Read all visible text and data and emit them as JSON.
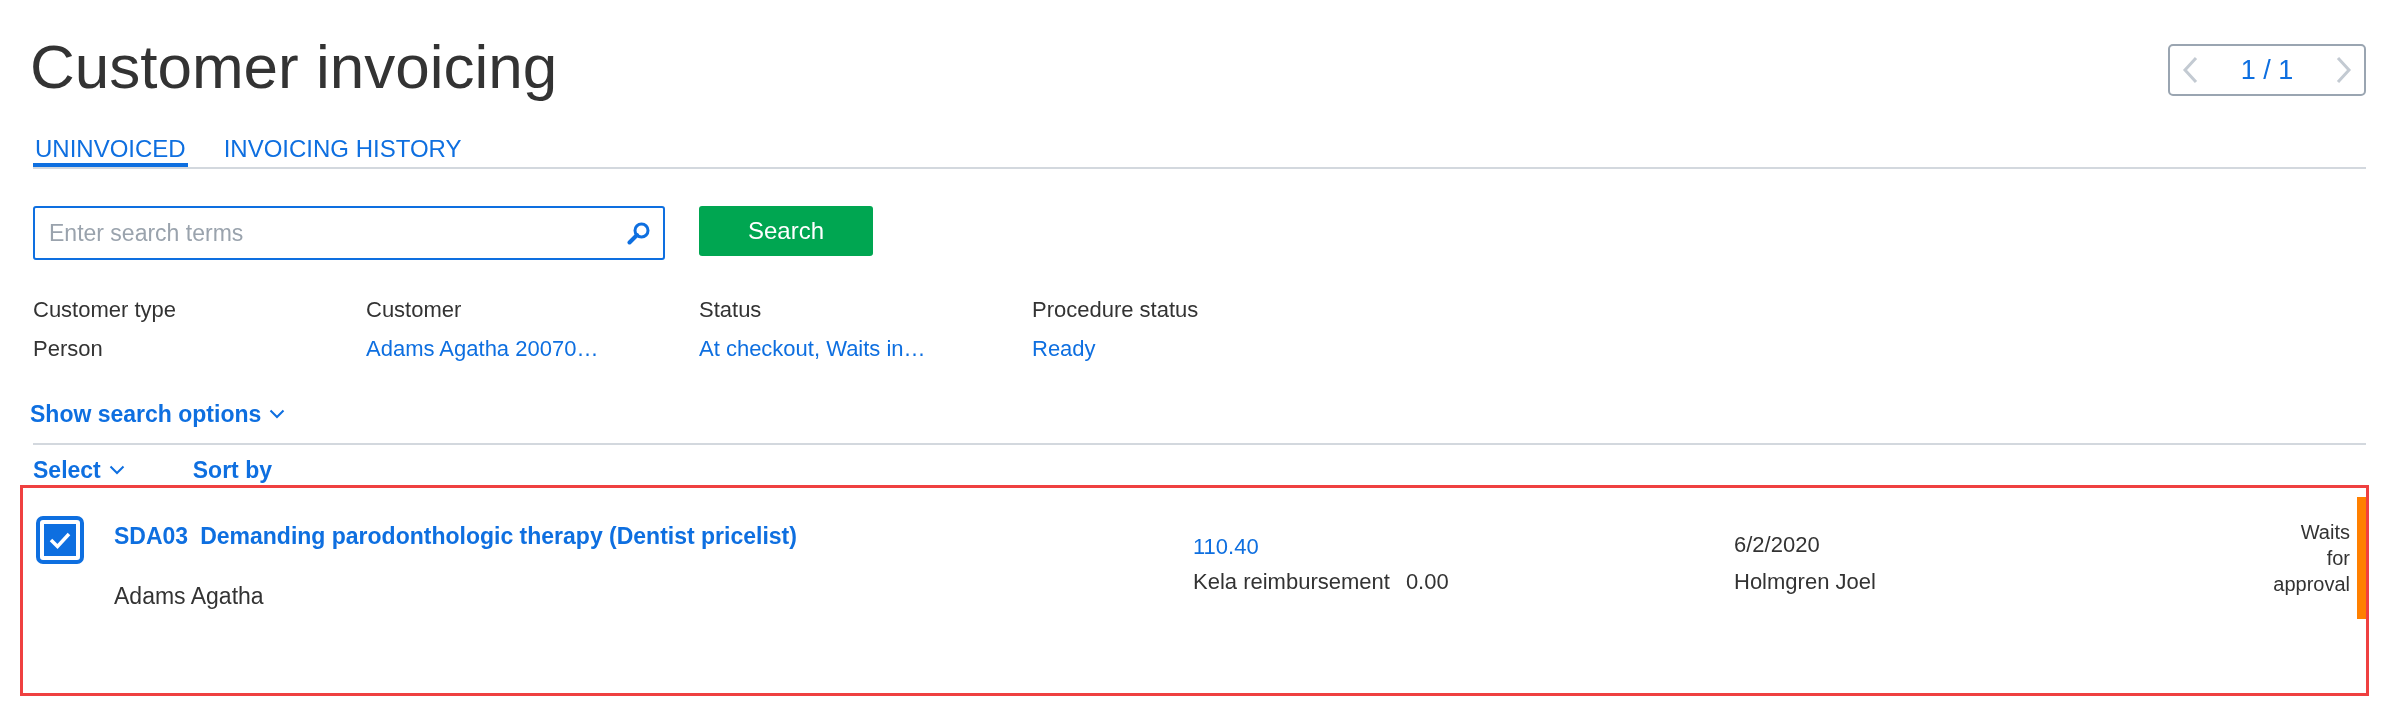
{
  "title": "Customer invoicing",
  "pager": {
    "label": "1 / 1",
    "prev_disabled": true,
    "next_disabled": true
  },
  "tabs": [
    {
      "label": "UNINVOICED",
      "selected": true
    },
    {
      "label": "INVOICING HISTORY",
      "selected": false
    }
  ],
  "search": {
    "placeholder": "Enter search terms",
    "button": "Search"
  },
  "filters": [
    {
      "label": "Customer type",
      "value": "Person",
      "kind": "text"
    },
    {
      "label": "Customer",
      "value": "Adams Agatha 20070…",
      "kind": "link"
    },
    {
      "label": "Status",
      "value": "At checkout, Waits in…",
      "kind": "link"
    },
    {
      "label": "Procedure status",
      "value": "Ready",
      "kind": "link"
    }
  ],
  "search_options": "Show search options",
  "list_toolbar": {
    "select": "Select",
    "sort": "Sort by"
  },
  "rows": [
    {
      "selected": true,
      "highlighted": true,
      "code": "SDA03",
      "title": "Demanding parodonthologic therapy (Dentist pricelist)",
      "customer": "Adams Agatha",
      "amount": "110.40",
      "reimbursement_label": "Kela reimbursement",
      "reimbursement": "0.00",
      "date": "6/2/2020",
      "handler": "Holmgren Joel",
      "status": {
        "label": "Waits for approval",
        "color": "#ff8000"
      }
    }
  ]
}
